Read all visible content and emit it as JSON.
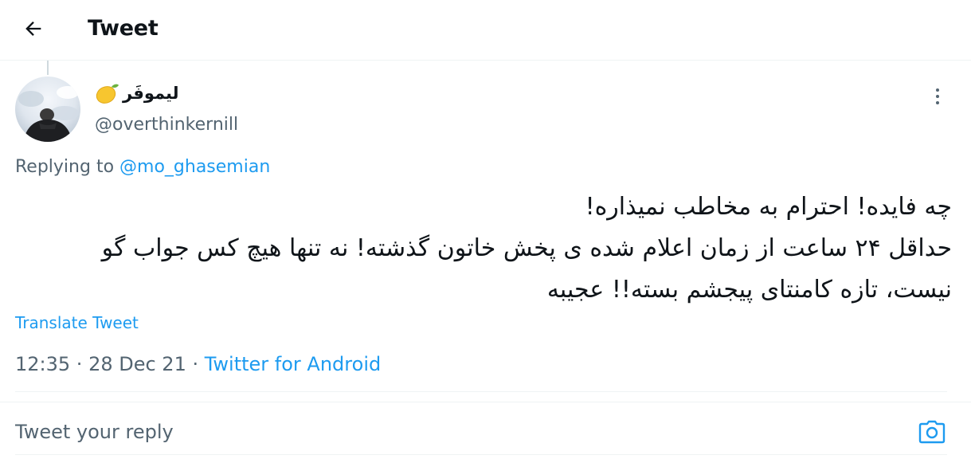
{
  "header": {
    "title": "Tweet"
  },
  "tweet": {
    "display_name": "لیموفَر",
    "emoji_icon": "lemon-icon",
    "handle": "@overthinkernill",
    "replying_prefix": "Replying to ",
    "replying_to": "@mo_ghasemian",
    "body_lines": [
      "چه فایده! احترام به مخاطب نمیذاره!",
      "حداقل ۲۴ ساعت از زمان اعلام شده ی پخش خاتون گذشته! نه تنها هیچ کس جواب گو",
      "نیست، تازه کامنتای پیجشم بسته!! عجیبه"
    ],
    "translate_label": "Translate Tweet",
    "time": "12:35",
    "date": "28 Dec 21",
    "source": "Twitter for Android",
    "separator": " · "
  },
  "reply": {
    "placeholder": "Tweet your reply"
  },
  "colors": {
    "accent": "#1d9bf0",
    "text_primary": "#0f1419",
    "text_secondary": "#536471",
    "divider": "#eff3f4"
  }
}
